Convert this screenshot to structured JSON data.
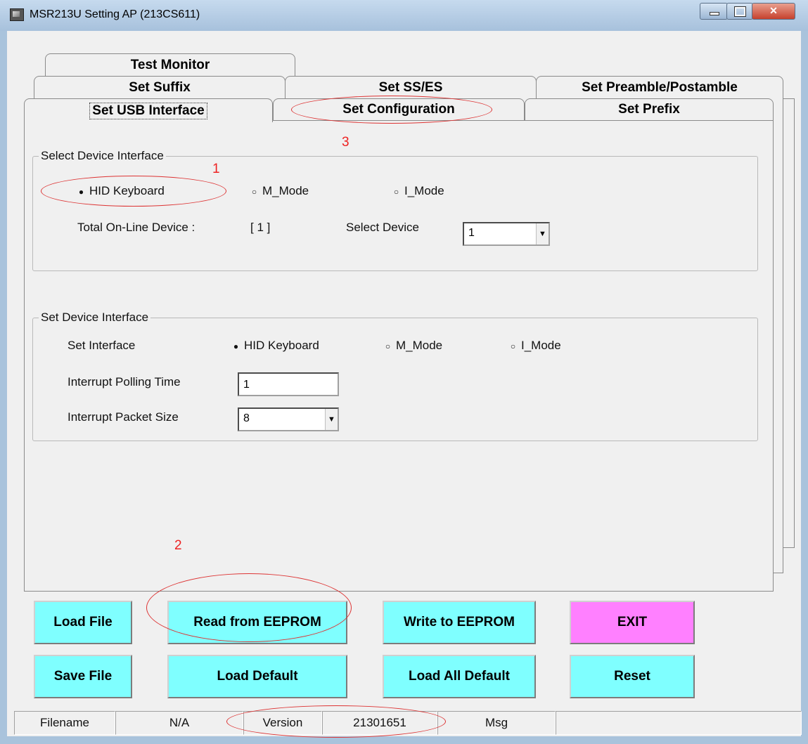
{
  "window": {
    "title": "MSR213U Setting AP (213CS611)"
  },
  "tabs": {
    "row1": [
      "Test Monitor"
    ],
    "row2": [
      "Set Suffix",
      "Set SS/ES",
      "Set Preamble/Postamble"
    ],
    "row3": [
      "Set USB Interface",
      "Set Configuration",
      "Set Prefix"
    ]
  },
  "select_device_interface": {
    "title": "Select Device Interface",
    "options": [
      "HID Keyboard",
      "M_Mode",
      "I_Mode"
    ],
    "selected": "HID Keyboard",
    "total_label": "Total On-Line Device :",
    "total_value": "[ 1 ]",
    "select_label": "Select Device",
    "select_value": "1"
  },
  "set_device_interface": {
    "title": "Set Device Interface",
    "interface_label": "Set Interface",
    "options": [
      "HID Keyboard",
      "M_Mode",
      "I_Mode"
    ],
    "selected": "HID Keyboard",
    "polling_label": "Interrupt Polling Time",
    "polling_value": "1",
    "packet_label": "Interrupt Packet Size",
    "packet_value": "8"
  },
  "buttons": {
    "load_file": "Load File",
    "read_eeprom": "Read from EEPROM",
    "write_eeprom": "Write to EEPROM",
    "exit": "EXIT",
    "save_file": "Save File",
    "load_default": "Load Default",
    "load_all_default": "Load  All Default",
    "reset": "Reset"
  },
  "status_bar": {
    "filename_label": "Filename",
    "filename_value": "N/A",
    "version_label": "Version",
    "version_value": "21301651",
    "msg_label": "Msg",
    "msg_value": ""
  },
  "annotations": {
    "step1": "1",
    "step2": "2",
    "step3": "3"
  },
  "icons": {
    "radio_checked": "●",
    "radio_unchecked": "○",
    "dropdown": "▼"
  },
  "colors": {
    "button_cyan": "#7fffff",
    "button_exit": "#ff80ff",
    "annotation_red": "#dd2222"
  }
}
